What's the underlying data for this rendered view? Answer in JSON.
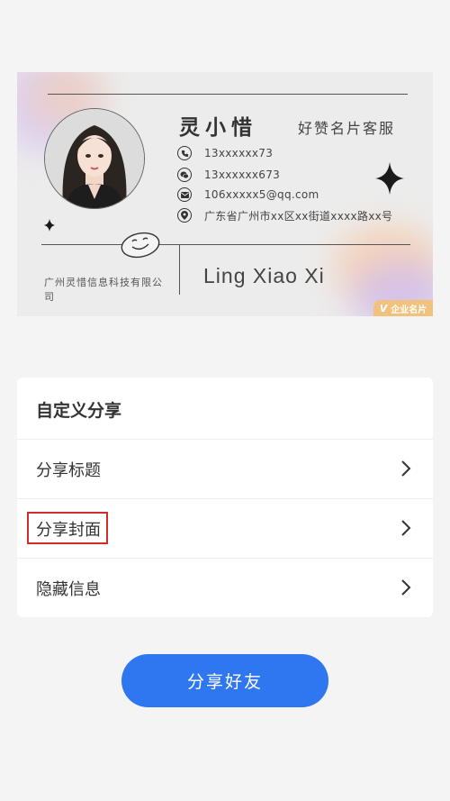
{
  "card": {
    "name": "灵小惜",
    "role": "好赞名片客服",
    "phone": "13xxxxxx73",
    "wechat": "13xxxxxx673",
    "email": "106xxxxx5@qq.com",
    "address": "广东省广州市xx区xx街道xxxx路xx号",
    "company": "广州灵惜信息科技有限公司",
    "pinyin_name": "Ling Xiao Xi",
    "badge_label": "企业名片",
    "badge_mark": "V"
  },
  "icons": [
    "phone-icon",
    "wechat-icon",
    "email-icon",
    "location-icon",
    "sparkle-icon",
    "smiley-icon",
    "chevron-right-icon"
  ],
  "share_panel": {
    "title": "自定义分享",
    "items": [
      {
        "label": "分享标题"
      },
      {
        "label": "分享封面"
      },
      {
        "label": "隐藏信息"
      }
    ],
    "highlighted_item": "分享封面"
  },
  "actions": {
    "share_button_label": "分享好友"
  },
  "colors": {
    "accent": "#2f77f0",
    "highlight_box": "#d42b2b",
    "badge": "#f1c27d"
  }
}
